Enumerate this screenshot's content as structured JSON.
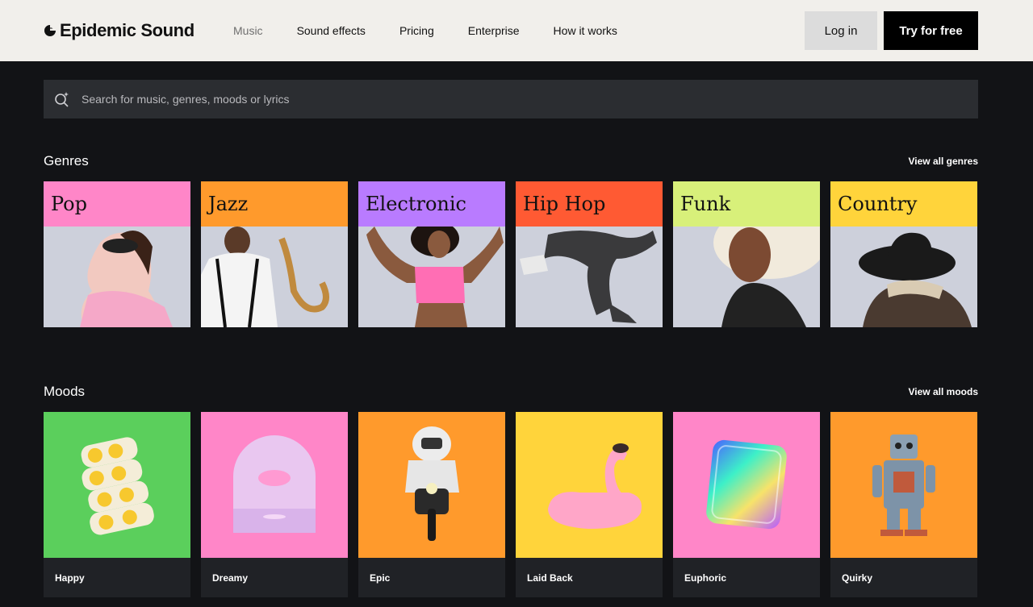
{
  "header": {
    "logo_text": "Epidemic Sound",
    "nav": [
      "Music",
      "Sound effects",
      "Pricing",
      "Enterprise",
      "How it works"
    ],
    "login_label": "Log in",
    "try_label": "Try for free"
  },
  "search": {
    "placeholder": "Search for music, genres, moods or lyrics"
  },
  "genres": {
    "title": "Genres",
    "view_all": "View all genres",
    "items": [
      {
        "label": "Pop",
        "color": "#ff86c8"
      },
      {
        "label": "Jazz",
        "color": "#ff9a2c"
      },
      {
        "label": "Electronic",
        "color": "#b97bff"
      },
      {
        "label": "Hip Hop",
        "color": "#ff5a33"
      },
      {
        "label": "Funk",
        "color": "#d8f07a"
      },
      {
        "label": "Country",
        "color": "#ffd43b"
      }
    ]
  },
  "moods": {
    "title": "Moods",
    "view_all": "View all moods",
    "items": [
      {
        "label": "Happy",
        "color": "#5bcf5c"
      },
      {
        "label": "Dreamy",
        "color": "#ff86c8"
      },
      {
        "label": "Epic",
        "color": "#ff9a2c"
      },
      {
        "label": "Laid Back",
        "color": "#ffd43b"
      },
      {
        "label": "Euphoric",
        "color": "#ff86c8"
      },
      {
        "label": "Quirky",
        "color": "#ff9a2c"
      }
    ]
  }
}
